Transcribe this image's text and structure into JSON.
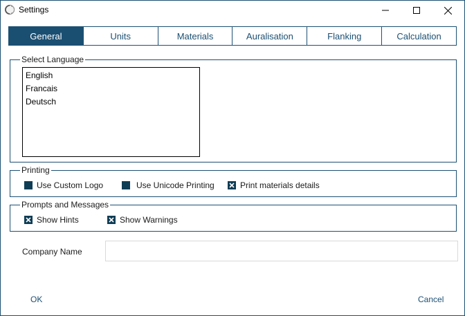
{
  "window": {
    "title": "Settings",
    "icon": "app-logo-icon"
  },
  "tabs": [
    {
      "label": "General",
      "active": true
    },
    {
      "label": "Units",
      "active": false
    },
    {
      "label": "Materials",
      "active": false
    },
    {
      "label": "Auralisation",
      "active": false
    },
    {
      "label": "Flanking",
      "active": false
    },
    {
      "label": "Calculation",
      "active": false
    }
  ],
  "language": {
    "group_label": "Select Language",
    "options": [
      "English",
      "Francais",
      "Deutsch"
    ]
  },
  "printing": {
    "group_label": "Printing",
    "options": [
      {
        "label": "Use Custom Logo",
        "checked": false
      },
      {
        "label": "Use Unicode Printing",
        "checked": false
      },
      {
        "label": "Print materials details",
        "checked": true
      }
    ]
  },
  "prompts": {
    "group_label": "Prompts and Messages",
    "options": [
      {
        "label": "Show Hints",
        "checked": true
      },
      {
        "label": "Show Warnings",
        "checked": true
      }
    ]
  },
  "company": {
    "label": "Company Name",
    "value": ""
  },
  "footer": {
    "ok_label": "OK",
    "cancel_label": "Cancel"
  },
  "colors": {
    "accent": "#1b4f72",
    "checkbox": "#0f3d55"
  }
}
